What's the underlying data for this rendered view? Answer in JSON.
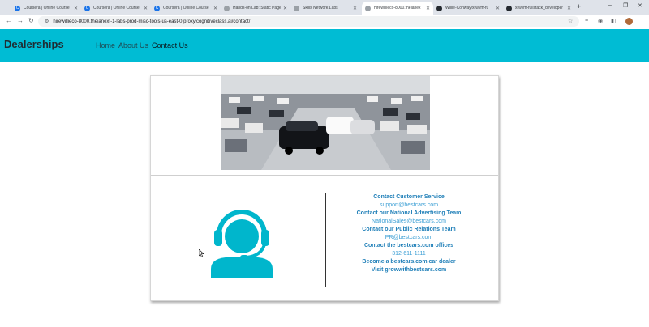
{
  "browser": {
    "tabs": [
      {
        "title": "Coursera | Online Course"
      },
      {
        "title": "Coursera | Online Course"
      },
      {
        "title": "Coursera | Online Course"
      },
      {
        "title": "Hands-on Lab: Static Page"
      },
      {
        "title": "Skills Network Labs"
      },
      {
        "title": "hirewillieco-8000.theianex"
      },
      {
        "title": "Willie-Conway/xrwvm-fu"
      },
      {
        "title": "xrwvm-fullstack_developer"
      }
    ],
    "url": "hirewillieco-8000.theianext-1-labs-prod-misc-tools-us-east-0.proxy.cognitiveclass.ai/contact/"
  },
  "navbar": {
    "brand": "Dealerships",
    "links": [
      "Home",
      "About Us",
      "Contact Us"
    ]
  },
  "contacts": [
    {
      "heading": "Contact Customer Service",
      "value": "support@bestcars.com"
    },
    {
      "heading": "Contact our National Advertising Team",
      "value": "NationalSales@bestcars.com"
    },
    {
      "heading": "Contact our Public Relations Team",
      "value": "PR@bestcars.com"
    },
    {
      "heading": "Contact the bestcars.com offices",
      "value": "312-611-1111"
    },
    {
      "heading": "Become a bestcars.com car dealer",
      "value": ""
    },
    {
      "heading": "Visit growwithbestcars.com",
      "value": ""
    }
  ],
  "colors": {
    "navbar": "#00bcd4",
    "support_icon": "#00b6cc",
    "contact_heading": "#1f7fb8",
    "contact_value": "#3a9ed4"
  }
}
